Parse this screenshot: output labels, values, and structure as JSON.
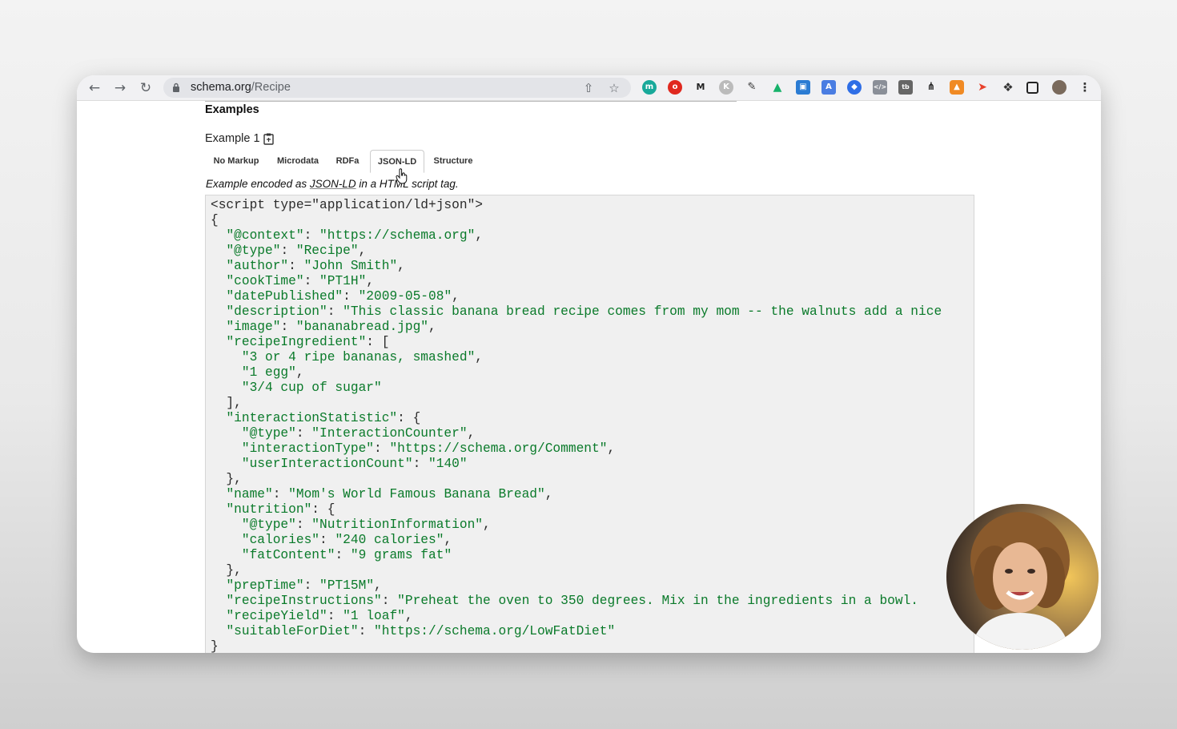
{
  "browser": {
    "url_domain": "schema.org",
    "url_path": "/Recipe"
  },
  "page": {
    "section_heading": "Examples",
    "example_label": "Example 1",
    "tabs": [
      {
        "label": "No Markup"
      },
      {
        "label": "Microdata"
      },
      {
        "label": "RDFa"
      },
      {
        "label": "JSON-LD"
      },
      {
        "label": "Structure"
      }
    ],
    "active_tab": "JSON-LD",
    "caption": {
      "pre": "Example encoded as ",
      "link": "JSON-LD",
      "post": " in a HTML script tag."
    }
  },
  "code_lines": [
    "<script type=\"application/ld+json\">",
    "{",
    "  \"@context\": \"https://schema.org\",",
    "  \"@type\": \"Recipe\",",
    "  \"author\": \"John Smith\",",
    "  \"cookTime\": \"PT1H\",",
    "  \"datePublished\": \"2009-05-08\",",
    "  \"description\": \"This classic banana bread recipe comes from my mom -- the walnuts add a nice",
    "  \"image\": \"bananabread.jpg\",",
    "  \"recipeIngredient\": [",
    "    \"3 or 4 ripe bananas, smashed\",",
    "    \"1 egg\",",
    "    \"3/4 cup of sugar\"",
    "  ],",
    "  \"interactionStatistic\": {",
    "    \"@type\": \"InteractionCounter\",",
    "    \"interactionType\": \"https://schema.org/Comment\",",
    "    \"userInteractionCount\": \"140\"",
    "  },",
    "  \"name\": \"Mom's World Famous Banana Bread\",",
    "  \"nutrition\": {",
    "    \"@type\": \"NutritionInformation\",",
    "    \"calories\": \"240 calories\",",
    "    \"fatContent\": \"9 grams fat\"",
    "  },",
    "  \"prepTime\": \"PT15M\",",
    "  \"recipeInstructions\": \"Preheat the oven to 350 degrees. Mix in the ingredients in a bowl.",
    "  \"recipeYield\": \"1 loaf\",",
    "  \"suitableForDiet\": \"https://schema.org/LowFatDiet\"",
    "}"
  ],
  "icons": {
    "back": "arrow-left-icon",
    "forward": "arrow-right-icon",
    "reload": "reload-icon",
    "lock": "lock-icon",
    "share": "share-icon",
    "bookmark": "star-icon",
    "extensions": "puzzle-icon",
    "side_panel": "side-panel-icon",
    "menu": "kebab-menu-icon",
    "copy": "clipboard-icon"
  },
  "colors": {
    "string": "#0a7a2a",
    "code_bg": "#f0f0f0"
  }
}
